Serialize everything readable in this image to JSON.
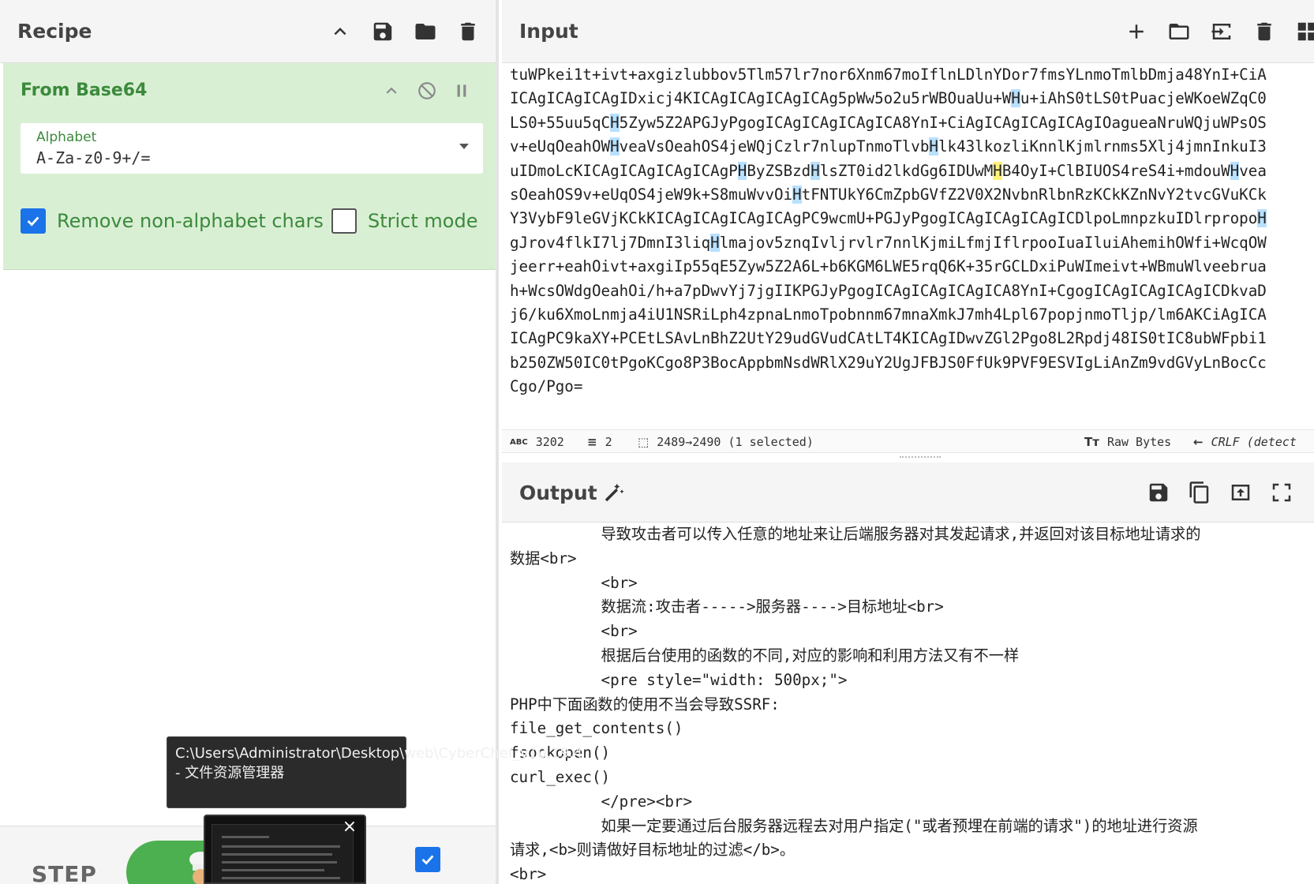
{
  "recipe": {
    "title": "Recipe",
    "operation": {
      "name": "From Base64",
      "alphabet_label": "Alphabet",
      "alphabet_value": "A-Za-z0-9+/=",
      "remove_non_alphabet_label": "Remove non-alphabet chars",
      "remove_non_alphabet_checked": true,
      "strict_mode_label": "Strict mode",
      "strict_mode_checked": false
    },
    "step_label": "STEP",
    "auto_bake_checked": true
  },
  "input": {
    "title": "Input",
    "lines": [
      [
        "tuWPkei1t+ivt+axgizlubbov5Tlm57lr7nor6Xnm67moIflnLDlnYDor7fmsYLnmoTmlbDmja48YnI+CiA"
      ],
      [
        "ICAgICAgICAgIDxicj4KICAgICAgICAgICAg5pWw5o2u5rWBOuaUu+W",
        {
          "h": "blue",
          "t": "H"
        },
        "u+iAhS0tLS0tPuacjeWKoeWZqC0"
      ],
      [
        "LS0+55uu5qC",
        {
          "h": "blue",
          "t": "H"
        },
        "5Zyw5Z2APGJyPgogICAgICAgICAgICA8YnI+CiAgICAgICAgICAgIOagueaNruWQjuWPsOS"
      ],
      [
        "v+eUqOeahOW",
        {
          "h": "blue",
          "t": "H"
        },
        "veaVsOeahOS4jeWQjCzlr7nlupTnmoTlvb",
        {
          "h": "blue",
          "t": "H"
        },
        "lk43lkozliKnnlKjmlrnms5Xlj4jmnInkuI3"
      ],
      [
        "uIDmoLcKICAgICAgICAgICAgP",
        {
          "h": "blue",
          "t": "H"
        },
        "ByZSBzd",
        {
          "h": "blue",
          "t": "H"
        },
        "lsZT0id2lkdGg6IDUwM",
        {
          "h": "yellow",
          "t": "H"
        },
        "B4OyI+ClBIUOS4reS4i+mdouW",
        {
          "h": "blue",
          "t": "H"
        },
        "vea"
      ],
      [
        "sOeahOS9v+eUqOS4jeW9k+S8muWvvOi",
        {
          "h": "blue",
          "t": "H"
        },
        "tFNTUkY6CmZpbGVfZ2V0X2NvbnRlbnRzKCkKZnNvY2tvcGVuKCk"
      ],
      [
        "Y3VybF9leGVjKCkKICAgICAgICAgICAgPC9wcmU+PGJyPgogICAgICAgICAgICDlpoLmnpzkuIDlrpropo",
        {
          "h": "blue",
          "t": "H"
        }
      ],
      [
        "gJrov4flkI7lj7DmnI3liq",
        {
          "h": "blue",
          "t": "H"
        },
        "lmajov5znqIvljrvlr7nnlKjmiLfmjIflrpooIuaIluiAhemihOWfi+WcqOW"
      ],
      [
        "jeerr+eahOivt+axgiIp55qE5Zyw5Z2A6L+b6KGM6LWE5rqQ6K+35rGCLDxiPuWImeivt+WBmuWlveebrua"
      ],
      [
        "h+WcsOWdgOeahOi/h+a7pDwvYj7jgIIKPGJyPgogICAgICAgICAgICA8YnI+CgogICAgICAgICAgICDkvaD"
      ],
      [
        "j6/ku6XmoLnmja4iU1NSRiLph4zpnaLnmoTpobnnm67mnaXmkJ7mh4Lpl67popjnmoTljp/lm6AKCiAgICA"
      ],
      [
        "ICAgPC9kaXY+PCEtLSAvLnBhZ2UtY29udGVudCAtLT4KICAgIDwvZGl2Pgo8L2Rpdj48IS0tIC8ubWFpbi1"
      ],
      [
        "b250ZW50IC0tPgoKCgo8P3BocAppbmNsdWRlX29uY2UgJFBJS0FfUk9PVF9ESVIgLiAnZm9vdGVyLnBocCc"
      ],
      [
        "Cgo/Pgo="
      ]
    ],
    "status": {
      "length": "3202",
      "lines": "2",
      "selection": "2489→2490 (1 selected)",
      "encoding": "Raw Bytes",
      "eol": "CRLF (detect"
    }
  },
  "output": {
    "title": "Output",
    "lines": [
      "          导致攻击者可以传入任意的地址来让后端服务器对其发起请求,并返回对该目标地址请求的",
      "数据<br>",
      "          <br>",
      "          数据流:攻击者----->服务器---->目标地址<br>",
      "          <br>",
      "          根据后台使用的函数的不同,对应的影响和利用方法又有不一样",
      "          <pre style=\"width: 500px;\">",
      "PHP中下面函数的使用不当会导致SSRF:",
      "file_get_contents()",
      "fsockopen()",
      "curl_exec()",
      "          </pre><br>",
      "          如果一定要通过后台服务器远程去对用户指定(\"或者预埋在前端的请求\")的地址进行资源",
      "请求,<b>则请做好目标地址的过滤</b>。",
      "<br>"
    ]
  },
  "tooltip": {
    "text": "C:\\Users\\Administrator\\Desktop\\web\\CyberChef_v10.19.4 - 文件资源管理器"
  }
}
